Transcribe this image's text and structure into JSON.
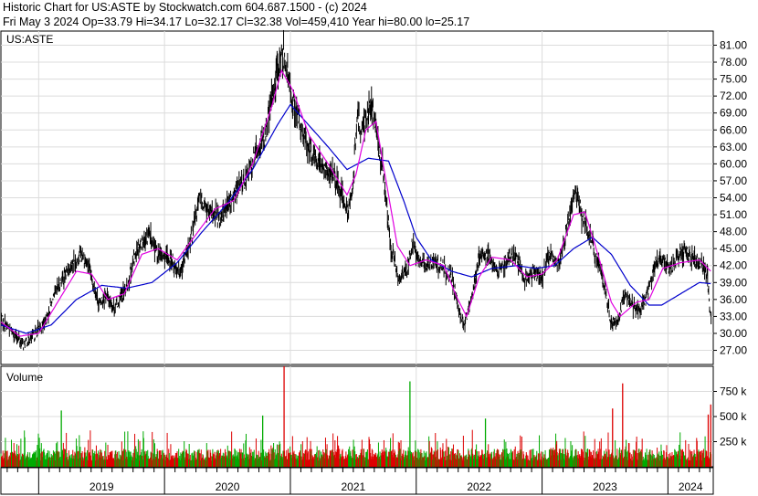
{
  "header": {
    "line1": "Historic Chart for US:ASTE by Stockwatch.com 604.687.1500 - (c) 2024",
    "line2": "Fri May  3 2024  Op=33.79  Hi=34.17  Lo=32.17  Cl=32.38  Vol=459,410  Year hi=80.00  lo=25.17"
  },
  "chart_data": [
    {
      "type": "line",
      "title": "US:ASTE",
      "ylim": [
        24.5,
        83.5
      ],
      "y_ticks": [
        81,
        78,
        75,
        72,
        69,
        66,
        63,
        60,
        57,
        54,
        51,
        48,
        45,
        42,
        39,
        36,
        33,
        30,
        27
      ],
      "y_tick_labels": [
        "81.00",
        "78.00",
        "75.00",
        "72.00",
        "69.00",
        "66.00",
        "63.00",
        "60.00",
        "57.00",
        "54.00",
        "51.00",
        "48.00",
        "45.00",
        "42.00",
        "39.00",
        "36.00",
        "33.00",
        "30.00",
        "27.00"
      ],
      "x_years": [
        "2019",
        "2020",
        "2021",
        "2022",
        "2023",
        "2024"
      ],
      "x_year_starts": [
        2019.0,
        2020.0,
        2021.0,
        2022.0,
        2023.0,
        2024.0
      ],
      "x_range": [
        2018.7,
        2024.36
      ],
      "grid": true,
      "colors": {
        "price": "#000000",
        "ma_short": "#e000e0",
        "ma_long": "#0000cc"
      },
      "price_anchors": [
        [
          2018.7,
          32.5
        ],
        [
          2018.78,
          30.5
        ],
        [
          2018.88,
          28.0
        ],
        [
          2018.96,
          29.5
        ],
        [
          2019.05,
          32.0
        ],
        [
          2019.15,
          38.0
        ],
        [
          2019.25,
          42.0
        ],
        [
          2019.35,
          44.0
        ],
        [
          2019.42,
          40.0
        ],
        [
          2019.48,
          35.0
        ],
        [
          2019.53,
          37.0
        ],
        [
          2019.6,
          34.5
        ],
        [
          2019.7,
          38.0
        ],
        [
          2019.78,
          45.0
        ],
        [
          2019.87,
          47.5
        ],
        [
          2019.95,
          44.0
        ],
        [
          2020.05,
          43.0
        ],
        [
          2020.12,
          41.0
        ],
        [
          2020.2,
          45.5
        ],
        [
          2020.28,
          54.0
        ],
        [
          2020.36,
          51.0
        ],
        [
          2020.44,
          50.5
        ],
        [
          2020.52,
          53.0
        ],
        [
          2020.6,
          56.0
        ],
        [
          2020.66,
          58.0
        ],
        [
          2020.73,
          62.0
        ],
        [
          2020.8,
          65.0
        ],
        [
          2020.86,
          72.0
        ],
        [
          2020.9,
          77.5
        ],
        [
          2020.95,
          79.5
        ],
        [
          2021.0,
          73.0
        ],
        [
          2021.06,
          68.0
        ],
        [
          2021.12,
          64.0
        ],
        [
          2021.18,
          61.0
        ],
        [
          2021.26,
          59.5
        ],
        [
          2021.34,
          58.0
        ],
        [
          2021.4,
          55.0
        ],
        [
          2021.46,
          51.0
        ],
        [
          2021.5,
          57.0
        ],
        [
          2021.53,
          68.0
        ],
        [
          2021.57,
          66.0
        ],
        [
          2021.62,
          70.0
        ],
        [
          2021.66,
          69.0
        ],
        [
          2021.7,
          63.0
        ],
        [
          2021.74,
          58.0
        ],
        [
          2021.77,
          51.0
        ],
        [
          2021.8,
          45.0
        ],
        [
          2021.86,
          40.0
        ],
        [
          2021.92,
          41.0
        ],
        [
          2021.97,
          45.5
        ],
        [
          2022.04,
          42.0
        ],
        [
          2022.12,
          42.5
        ],
        [
          2022.2,
          42.0
        ],
        [
          2022.28,
          40.0
        ],
        [
          2022.34,
          34.0
        ],
        [
          2022.38,
          31.5
        ],
        [
          2022.44,
          36.0
        ],
        [
          2022.5,
          44.0
        ],
        [
          2022.58,
          43.5
        ],
        [
          2022.64,
          41.0
        ],
        [
          2022.7,
          42.0
        ],
        [
          2022.76,
          44.5
        ],
        [
          2022.82,
          42.0
        ],
        [
          2022.86,
          39.0
        ],
        [
          2022.92,
          41.0
        ],
        [
          2023.0,
          40.0
        ],
        [
          2023.06,
          44.0
        ],
        [
          2023.13,
          42.0
        ],
        [
          2023.2,
          48.5
        ],
        [
          2023.26,
          55.0
        ],
        [
          2023.32,
          51.0
        ],
        [
          2023.38,
          47.0
        ],
        [
          2023.44,
          43.0
        ],
        [
          2023.5,
          38.0
        ],
        [
          2023.55,
          31.5
        ],
        [
          2023.6,
          32.0
        ],
        [
          2023.66,
          37.5
        ],
        [
          2023.72,
          35.0
        ],
        [
          2023.78,
          34.0
        ],
        [
          2023.84,
          37.0
        ],
        [
          2023.9,
          42.5
        ],
        [
          2023.96,
          43.0
        ],
        [
          2024.02,
          41.0
        ],
        [
          2024.08,
          44.0
        ],
        [
          2024.13,
          44.5
        ],
        [
          2024.18,
          43.5
        ],
        [
          2024.22,
          42.5
        ],
        [
          2024.28,
          42.0
        ],
        [
          2024.31,
          41.0
        ],
        [
          2024.33,
          35.0
        ],
        [
          2024.34,
          32.4
        ]
      ],
      "ma_long_anchors": [
        [
          2018.7,
          31.5
        ],
        [
          2018.9,
          30.0
        ],
        [
          2019.1,
          31.5
        ],
        [
          2019.3,
          36.0
        ],
        [
          2019.5,
          38.5
        ],
        [
          2019.7,
          38.0
        ],
        [
          2019.9,
          39.0
        ],
        [
          2020.1,
          42.5
        ],
        [
          2020.3,
          48.0
        ],
        [
          2020.5,
          53.0
        ],
        [
          2020.7,
          59.0
        ],
        [
          2020.9,
          67.0
        ],
        [
          2021.0,
          70.5
        ],
        [
          2021.1,
          68.0
        ],
        [
          2021.3,
          63.0
        ],
        [
          2021.45,
          59.0
        ],
        [
          2021.62,
          61.0
        ],
        [
          2021.78,
          60.5
        ],
        [
          2021.9,
          53.5
        ],
        [
          2022.0,
          47.0
        ],
        [
          2022.12,
          43.0
        ],
        [
          2022.28,
          41.0
        ],
        [
          2022.44,
          40.0
        ],
        [
          2022.6,
          41.5
        ],
        [
          2022.8,
          42.0
        ],
        [
          2022.95,
          41.5
        ],
        [
          2023.1,
          42.0
        ],
        [
          2023.25,
          45.0
        ],
        [
          2023.4,
          47.0
        ],
        [
          2023.55,
          44.0
        ],
        [
          2023.7,
          38.5
        ],
        [
          2023.85,
          35.0
        ],
        [
          2023.95,
          35.0
        ],
        [
          2024.1,
          37.0
        ],
        [
          2024.25,
          39.0
        ],
        [
          2024.34,
          38.8
        ]
      ],
      "ma_short_anchors": [
        [
          2018.7,
          32.0
        ],
        [
          2018.85,
          29.5
        ],
        [
          2019.0,
          30.0
        ],
        [
          2019.15,
          35.5
        ],
        [
          2019.3,
          41.0
        ],
        [
          2019.42,
          40.5
        ],
        [
          2019.55,
          36.0
        ],
        [
          2019.68,
          37.0
        ],
        [
          2019.82,
          44.0
        ],
        [
          2019.95,
          45.0
        ],
        [
          2020.1,
          43.0
        ],
        [
          2020.25,
          47.5
        ],
        [
          2020.4,
          52.0
        ],
        [
          2020.55,
          53.5
        ],
        [
          2020.7,
          60.0
        ],
        [
          2020.85,
          70.0
        ],
        [
          2020.93,
          76.5
        ],
        [
          2021.02,
          73.0
        ],
        [
          2021.15,
          65.0
        ],
        [
          2021.3,
          60.0
        ],
        [
          2021.45,
          54.5
        ],
        [
          2021.52,
          58.0
        ],
        [
          2021.6,
          66.0
        ],
        [
          2021.68,
          67.5
        ],
        [
          2021.76,
          57.0
        ],
        [
          2021.85,
          45.5
        ],
        [
          2021.95,
          42.0
        ],
        [
          2022.08,
          43.0
        ],
        [
          2022.22,
          42.0
        ],
        [
          2022.32,
          36.5
        ],
        [
          2022.4,
          33.0
        ],
        [
          2022.5,
          40.0
        ],
        [
          2022.6,
          43.5
        ],
        [
          2022.75,
          43.0
        ],
        [
          2022.88,
          40.0
        ],
        [
          2023.0,
          40.5
        ],
        [
          2023.12,
          43.0
        ],
        [
          2023.25,
          51.0
        ],
        [
          2023.34,
          51.5
        ],
        [
          2023.45,
          43.5
        ],
        [
          2023.55,
          35.5
        ],
        [
          2023.62,
          33.0
        ],
        [
          2023.75,
          35.5
        ],
        [
          2023.85,
          36.0
        ],
        [
          2023.96,
          41.5
        ],
        [
          2024.1,
          42.5
        ],
        [
          2024.25,
          43.0
        ],
        [
          2024.34,
          41.0
        ]
      ]
    },
    {
      "type": "bar",
      "title": "Volume",
      "ylim": [
        0,
        1000
      ],
      "y_ticks": [
        750,
        500,
        250
      ],
      "y_tick_labels": [
        "750 k",
        "500 k",
        "250 k"
      ],
      "colors": {
        "up": "#00aa00",
        "down": "#dd0000"
      },
      "spikes": [
        [
          2020.95,
          1000,
          "down"
        ],
        [
          2021.95,
          850,
          "up"
        ],
        [
          2023.64,
          830,
          "down"
        ],
        [
          2023.56,
          580,
          "down"
        ],
        [
          2024.34,
          620,
          "down"
        ],
        [
          2019.18,
          560,
          "up"
        ],
        [
          2020.78,
          510,
          "up"
        ],
        [
          2024.32,
          520,
          "down"
        ],
        [
          2022.55,
          480,
          "up"
        ]
      ]
    }
  ]
}
